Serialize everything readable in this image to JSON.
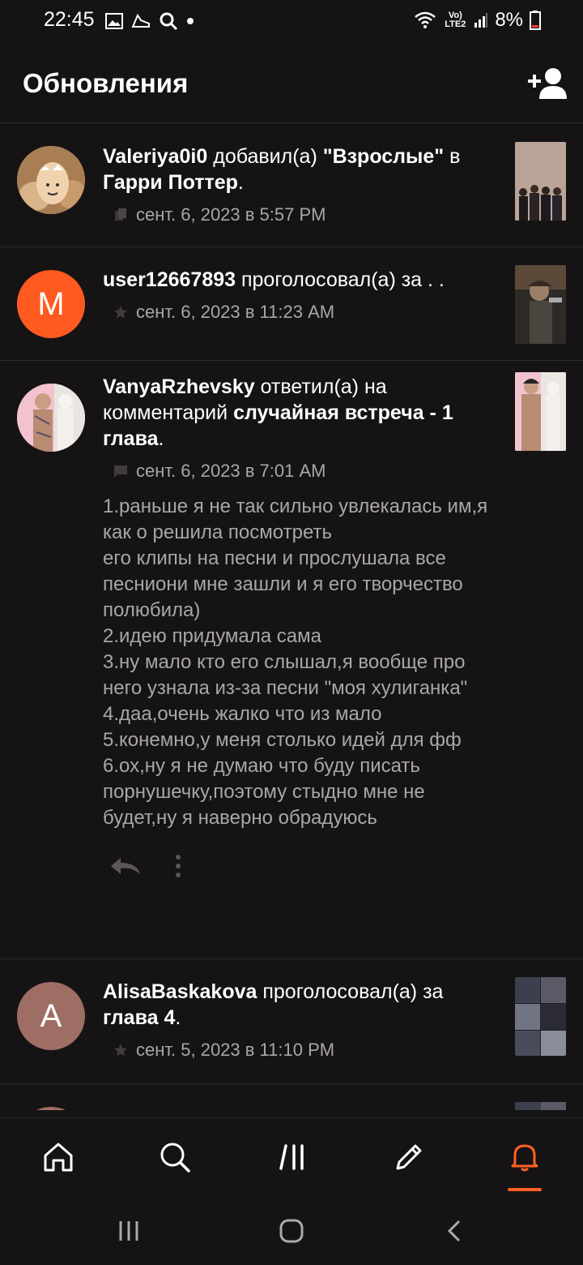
{
  "status_bar": {
    "time": "22:45",
    "network": "Vo) LTE2",
    "battery_percent": "8%"
  },
  "header": {
    "title": "Обновления",
    "action_icon": "add-user-icon"
  },
  "feed": [
    {
      "user": "Valeriya0i0",
      "action": " добавил(а) ",
      "object": "\"Взрослые\"",
      "suffix": " в ",
      "target": "Гарри Поттер",
      "end": ".",
      "meta_icon": "reading-list-icon",
      "time": "сент. 6, 2023 в 5:57 PM"
    },
    {
      "user": "user12667893",
      "action": " проголосовал(а) за . .",
      "avatar_letter": "M",
      "avatar_color": "#ff5a1f",
      "meta_icon": "star-icon",
      "time": "сент. 6, 2023 в 11:23 AM"
    },
    {
      "user": "VanyaRzhevsky",
      "action": " ответил(а) на комментарий ",
      "target": "случайная встреча - 1 глава",
      "end": ".",
      "meta_icon": "comment-icon",
      "time": "сент. 6, 2023 в 7:01 AM",
      "comment": "1.раньше я не так сильно увлекалась им,я как о решила посмотреть\nего клипы на песни  и прослушала все песниони мне зашли и я его творчество полюбила)\n2.идею придумала сама\n3.ну мало кто его слышал,я вообще про него узнала из-за песни \"моя хулиганка\"\n4.даа,очень жалко что из мало\n5.конемно,у меня столько идей для фф\n6.ох,ну я не думаю что буду писать порнушечку,поэтому стыдно мне не будет,ну я наверно обрадуюсь"
    },
    {
      "user": "AlisaBaskakova",
      "action": " проголосовал(а) за ",
      "target": "глава 4",
      "end": ".",
      "avatar_letter": "A",
      "avatar_color": "#9e6d63",
      "meta_icon": "star-icon",
      "time": "сент. 5, 2023 в 11:10 PM"
    }
  ],
  "bottom_nav": {
    "items": [
      "home-icon",
      "search-icon",
      "library-icon",
      "write-icon",
      "notifications-icon"
    ],
    "active": "notifications-icon",
    "accent": "#ff6122"
  }
}
